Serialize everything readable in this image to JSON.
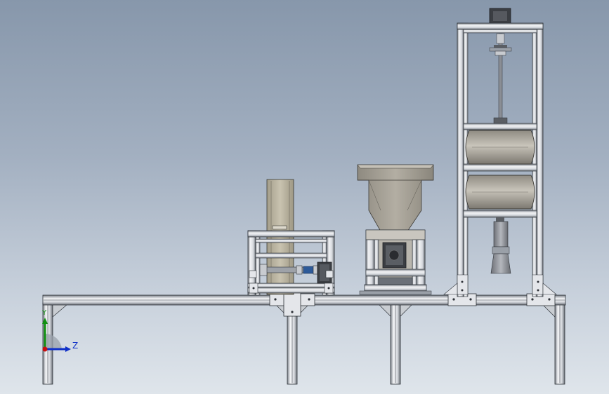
{
  "viewport": {
    "background_top": "#8797ab",
    "background_bottom": "#dfe5eb"
  },
  "triad": {
    "z_label": "Z",
    "y_label": "Y",
    "z_color": "#1030c8",
    "y_color": "#109010",
    "x_color": "#c81010"
  },
  "model": {
    "frame_color": "#dcdfe4",
    "frame_edge": "#2e3238",
    "housing_color": "#b7b09d",
    "hopper_color": "#a39e93",
    "drum_color": "#aaa69c",
    "motor_color": "#3b3e43"
  }
}
